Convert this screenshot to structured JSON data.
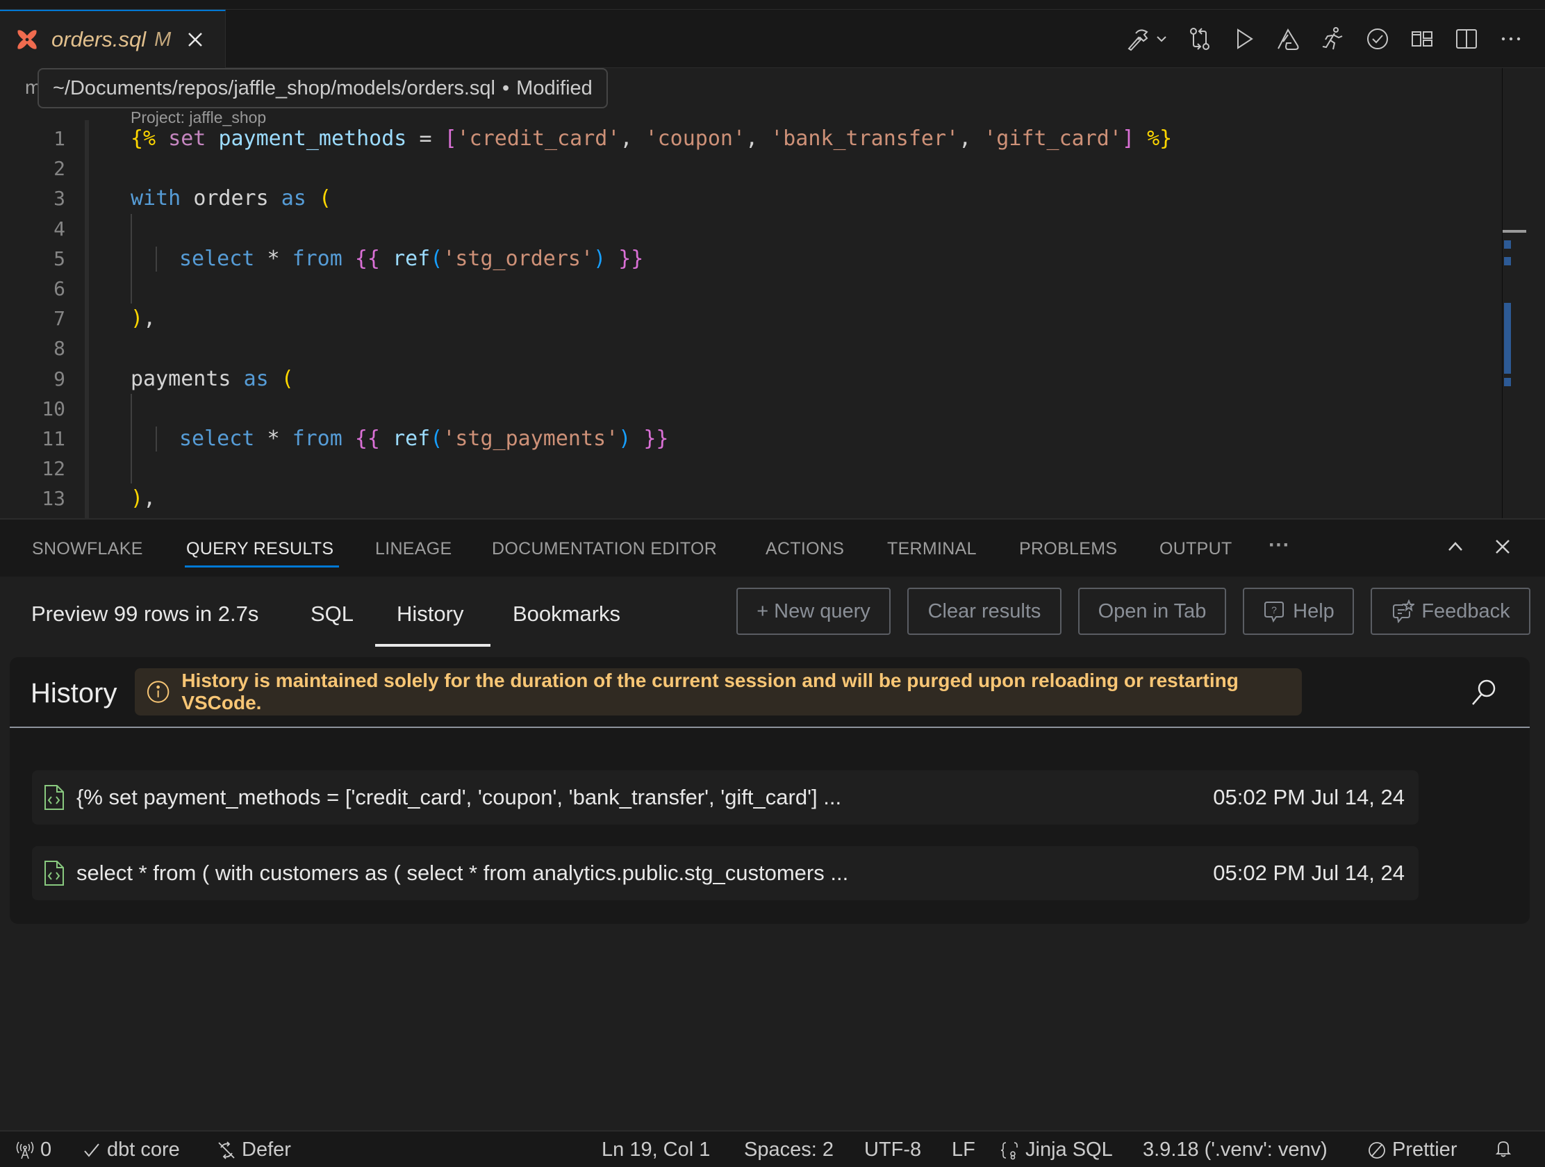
{
  "editor_tab": {
    "filename": "orders.sql",
    "modified_badge": "M",
    "icon": "dbt-logo-icon"
  },
  "toolbar": {
    "icons": [
      "hammer-build-icon",
      "chevron-down-icon",
      "compare-changes-icon",
      "run-icon",
      "altimate-icon",
      "run-person-icon",
      "check-circle-icon",
      "layout-icon",
      "split-editor-icon",
      "more-actions-icon"
    ]
  },
  "tooltip": {
    "path": "~/Documents/repos/jaffle_shop/models/orders.sql",
    "separator": "•",
    "status": "Modified"
  },
  "breadcrumb_fragment": "m",
  "codelens": "Project: jaffle_shop",
  "code_lines": [
    {
      "n": "1"
    },
    {
      "n": "2"
    },
    {
      "n": "3"
    },
    {
      "n": "4"
    },
    {
      "n": "5"
    },
    {
      "n": "6"
    },
    {
      "n": "7"
    },
    {
      "n": "8"
    },
    {
      "n": "9"
    },
    {
      "n": "10"
    },
    {
      "n": "11"
    },
    {
      "n": "12"
    },
    {
      "n": "13"
    }
  ],
  "code_tokens": {
    "l1": {
      "open": "{%",
      "set": "set",
      "var": "payment_methods",
      "eq": "=",
      "lb": "[",
      "s1": "'credit_card'",
      "c1": ",",
      "s2": "'coupon'",
      "c2": ",",
      "s3": "'bank_transfer'",
      "c3": ",",
      "s4": "'gift_card'",
      "rb": "]",
      "close": "%}"
    },
    "l3": {
      "with": "with",
      "name": "orders",
      "as": "as",
      "paren": "("
    },
    "l5": {
      "select": "select",
      "star": "*",
      "from": "from",
      "open": "{{",
      "ref": "ref",
      "lp": "(",
      "str": "'stg_orders'",
      "rp": ")",
      "close": "}}"
    },
    "l7": {
      "paren": ")",
      "comma": ","
    },
    "l9": {
      "name": "payments",
      "as": "as",
      "paren": "("
    },
    "l11": {
      "select": "select",
      "star": "*",
      "from": "from",
      "open": "{{",
      "ref": "ref",
      "lp": "(",
      "str": "'stg_payments'",
      "rp": ")",
      "close": "}}"
    },
    "l13": {
      "paren": ")",
      "comma": ","
    }
  },
  "panel": {
    "tabs": [
      {
        "label": "SNOWFLAKE",
        "active": false
      },
      {
        "label": "QUERY RESULTS",
        "active": true
      },
      {
        "label": "LINEAGE",
        "active": false
      },
      {
        "label": "DOCUMENTATION EDITOR",
        "active": false
      },
      {
        "label": "ACTIONS",
        "active": false
      },
      {
        "label": "TERMINAL",
        "active": false
      },
      {
        "label": "PROBLEMS",
        "active": false
      },
      {
        "label": "OUTPUT",
        "active": false
      }
    ],
    "more_label": "···"
  },
  "query_results": {
    "preview_text": "Preview 99 rows in 2.7s",
    "subtabs": [
      {
        "label": "SQL",
        "active": false
      },
      {
        "label": "History",
        "active": true
      },
      {
        "label": "Bookmarks",
        "active": false
      }
    ],
    "buttons": {
      "new_query": "+ New query",
      "clear_results": "Clear results",
      "open_in_tab": "Open in Tab",
      "help": "Help",
      "feedback": "Feedback"
    },
    "history": {
      "title": "History",
      "notice": "History is maintained solely for the duration of the current session and will be purged upon reloading or restarting VSCode.",
      "items": [
        {
          "query": "{% set payment_methods = ['credit_card', 'coupon', 'bank_transfer', 'gift_card'] ...",
          "time": "05:02 PM Jul 14, 24"
        },
        {
          "query": "select * from ( with customers as ( select * from analytics.public.stg_customers ...",
          "time": "05:02 PM Jul 14, 24"
        }
      ]
    }
  },
  "statusbar": {
    "ports": "0",
    "dbt": "dbt core",
    "defer": "Defer",
    "position": "Ln 19, Col 1",
    "spaces": "Spaces: 2",
    "encoding": "UTF-8",
    "eol": "LF",
    "language": "Jinja SQL",
    "python": "3.9.18 ('.venv': venv)",
    "prettier": "Prettier"
  },
  "colors": {
    "accent": "#0078d4",
    "notice_text": "#f8c675",
    "notice_bg": "#302a22",
    "modified": "#e2c08d",
    "dbt_logo": "#f06b4f"
  }
}
